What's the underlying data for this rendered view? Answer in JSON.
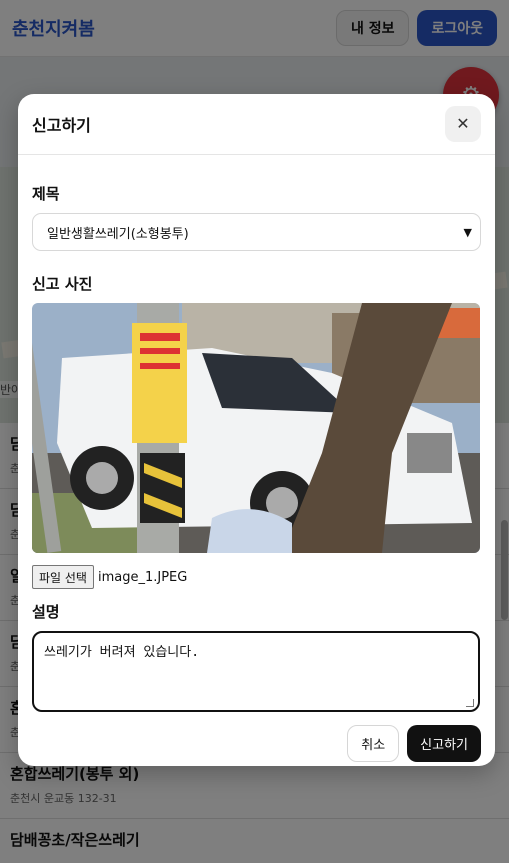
{
  "app": {
    "brand": "춘천지켜봄"
  },
  "header": {
    "my_info_label": "내 정보",
    "logout_label": "로그아웃"
  },
  "map": {
    "partial_label": "반아"
  },
  "list": {
    "items": [
      {
        "title": "담",
        "address": "춘"
      },
      {
        "title": "담",
        "address": "춘"
      },
      {
        "title": "일",
        "address": "춘"
      },
      {
        "title": "담",
        "address": "춘"
      },
      {
        "title": "혼",
        "address": "춘"
      },
      {
        "title": "혼합쓰레기(봉투 외)",
        "address": "춘천시 운교동 132-31"
      },
      {
        "title": "담배꽁초/작은쓰레기",
        "address": ""
      }
    ]
  },
  "modal": {
    "title": "신고하기",
    "close_icon": "close-icon",
    "subject_label": "제목",
    "subject_value": "일반생활쓰레기(소형봉투)",
    "photo_label": "신고 사진",
    "file_button_label": "파일 선택",
    "file_name": "image_1.JPEG",
    "description_label": "설명",
    "description_value": "쓰레기가 버려져 있습니다.",
    "cancel_label": "취소",
    "submit_label": "신고하기"
  },
  "colors": {
    "brand": "#2b57c9",
    "fab": "#e0323c",
    "submit": "#111111"
  }
}
